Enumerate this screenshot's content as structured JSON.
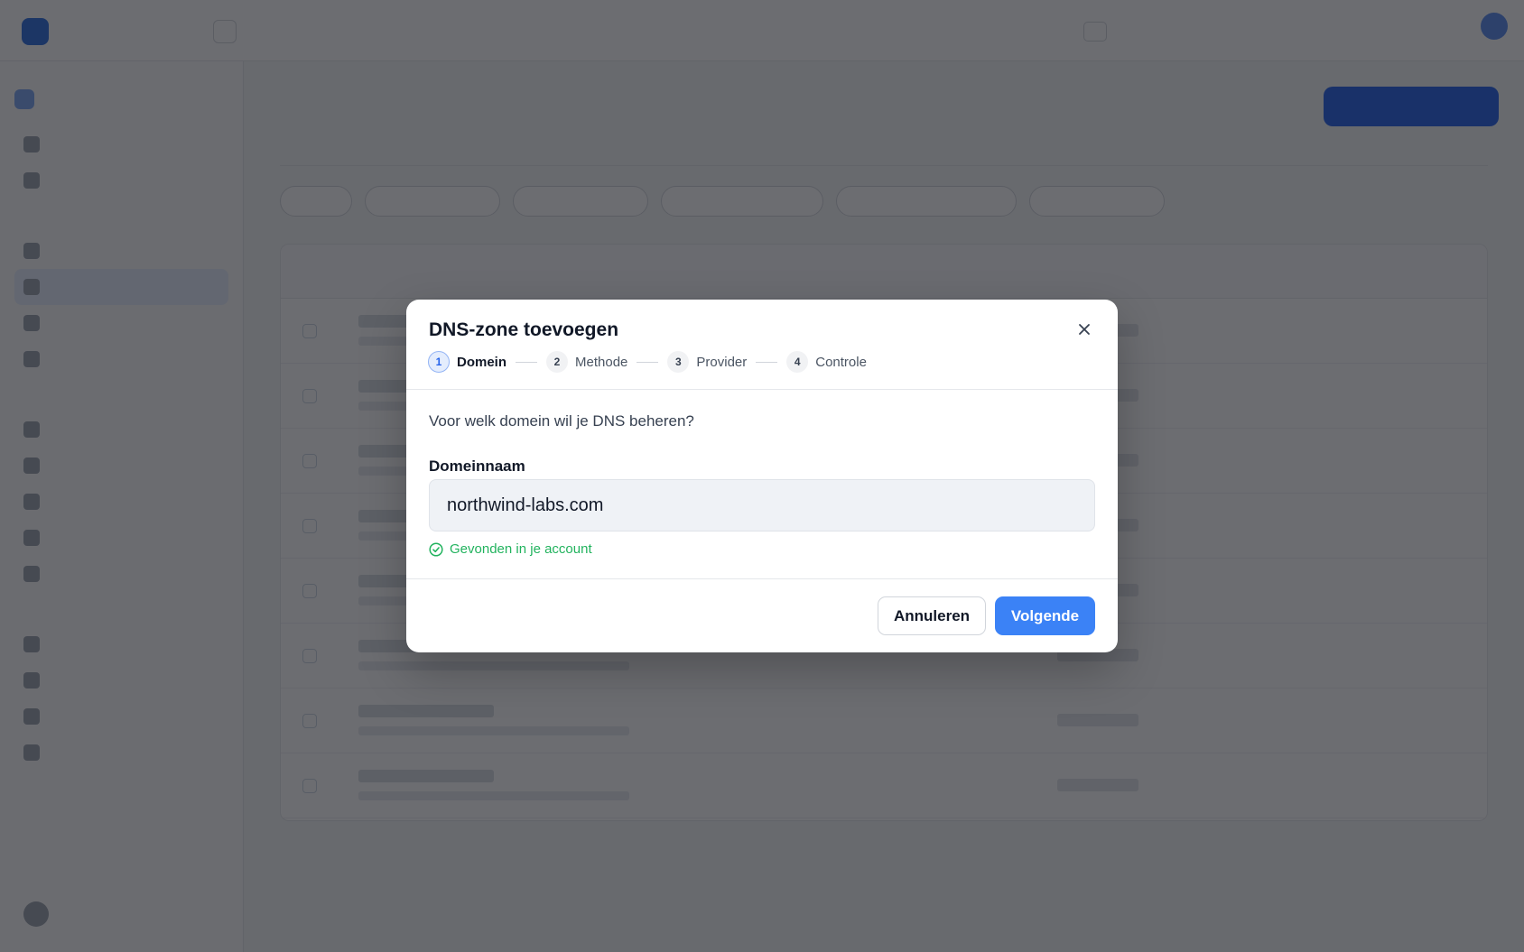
{
  "modal": {
    "title": "DNS-zone toevoegen",
    "steps": [
      {
        "number": "1",
        "label": "Domein",
        "active": true
      },
      {
        "number": "2",
        "label": "Methode",
        "active": false
      },
      {
        "number": "3",
        "label": "Provider",
        "active": false
      },
      {
        "number": "4",
        "label": "Controle",
        "active": false
      }
    ],
    "question": "Voor welk domein wil je DNS beheren?",
    "domain_field": {
      "label": "Domeinnaam",
      "value": "northwind-labs.com"
    },
    "validation_message": "Gevonden in je account",
    "buttons": {
      "cancel": "Annuleren",
      "next": "Volgende"
    }
  },
  "colors": {
    "accent": "#3b82f6",
    "success": "#22b35e",
    "overlay": "rgba(17,20,26,0.62)"
  },
  "icons": {
    "close": "close-icon",
    "validation": "check-circle-icon"
  }
}
